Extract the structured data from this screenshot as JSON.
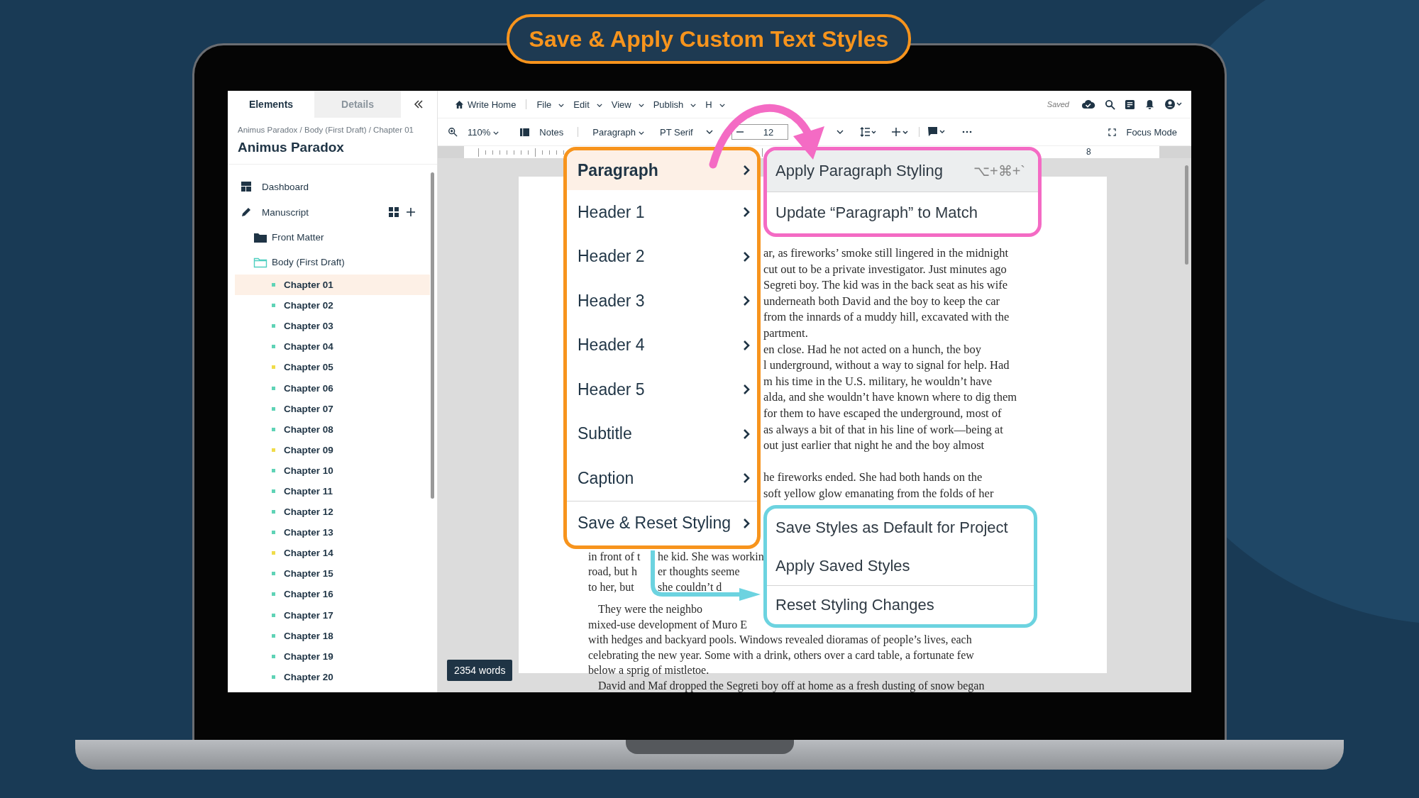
{
  "banner": {
    "title": "Save & Apply Custom Text Styles"
  },
  "sidebar": {
    "tabs": [
      {
        "label": "Elements",
        "selected": true
      },
      {
        "label": "Details",
        "selected": false
      }
    ],
    "breadcrumb": "Animus Paradox / Body (First Draft) / Chapter 01",
    "project_title": "Animus Paradox",
    "nav": [
      {
        "label": "Dashboard",
        "kind": "dashboard"
      },
      {
        "label": "Manuscript",
        "kind": "manuscript"
      }
    ],
    "folders": [
      {
        "label": "Front Matter",
        "kind": "closed"
      },
      {
        "label": "Body (First Draft)",
        "kind": "open"
      }
    ],
    "chapters": [
      {
        "label": "Chapter 01",
        "color": "#5fd3b6",
        "selected": true
      },
      {
        "label": "Chapter 02",
        "color": "#5fd3b6",
        "selected": false
      },
      {
        "label": "Chapter 03",
        "color": "#5fd3b6",
        "selected": false
      },
      {
        "label": "Chapter 04",
        "color": "#5fd3b6",
        "selected": false
      },
      {
        "label": "Chapter 05",
        "color": "#f0dc4a",
        "selected": false
      },
      {
        "label": "Chapter 06",
        "color": "#5fd3b6",
        "selected": false
      },
      {
        "label": "Chapter 07",
        "color": "#5fd3b6",
        "selected": false
      },
      {
        "label": "Chapter 08",
        "color": "#5fd3b6",
        "selected": false
      },
      {
        "label": "Chapter 09",
        "color": "#f0dc4a",
        "selected": false
      },
      {
        "label": "Chapter 10",
        "color": "#5fd3b6",
        "selected": false
      },
      {
        "label": "Chapter 11",
        "color": "#5fd3b6",
        "selected": false
      },
      {
        "label": "Chapter 12",
        "color": "#5fd3b6",
        "selected": false
      },
      {
        "label": "Chapter 13",
        "color": "#5fd3b6",
        "selected": false
      },
      {
        "label": "Chapter 14",
        "color": "#f0dc4a",
        "selected": false
      },
      {
        "label": "Chapter 15",
        "color": "#5fd3b6",
        "selected": false
      },
      {
        "label": "Chapter 16",
        "color": "#5fd3b6",
        "selected": false
      },
      {
        "label": "Chapter 17",
        "color": "#5fd3b6",
        "selected": false
      },
      {
        "label": "Chapter 18",
        "color": "#5fd3b6",
        "selected": false
      },
      {
        "label": "Chapter 19",
        "color": "#5fd3b6",
        "selected": false
      },
      {
        "label": "Chapter 20",
        "color": "#5fd3b6",
        "selected": false
      }
    ]
  },
  "menubar": {
    "home": "Write Home",
    "menus": [
      "File",
      "Edit",
      "View",
      "Publish",
      "H"
    ],
    "status": "Saved"
  },
  "toolbar": {
    "zoom": "110%",
    "notes": "Notes",
    "style": "Paragraph",
    "font": "PT Serif",
    "font_size": "12",
    "focus": "Focus Mode"
  },
  "ruler": {
    "mark": "8"
  },
  "document": {
    "word_count": "2354 words",
    "top_lines": [
      "ar, as fireworks’ smoke still lingered in the midnight",
      "cut out to be a private investigator. Just minutes ago",
      "Segreti boy. The kid was in the back seat as his wife",
      "underneath both David and the boy to keep the car",
      "from the innards of a muddy hill, excavated with the",
      "partment.",
      "en close. Had he not acted on a hunch, the boy",
      "l underground, without a way to signal for help. Had",
      "m his time in the U.S. military, he wouldn’t have",
      "alda, and she wouldn’t have known where to dig them",
      "for them to have escaped the underground, most of",
      "as always a bit of that in his line of work—being at",
      "out just earlier that night he and the boy almost"
    ],
    "middle_lines": [
      "he fireworks ended. She had both hands on the",
      "soft yellow glow emanating from the folds of her"
    ],
    "bottom_lines": [
      {
        "parts": [
          "in front of t",
          "he kid. She was workin"
        ],
        "indent": false
      },
      {
        "parts": [
          "road, but h",
          "er thoughts seeme"
        ],
        "indent": false
      },
      {
        "parts": [
          "to her, but",
          "she couldn’t d"
        ],
        "indent": false
      },
      {
        "parts": [
          "They were the neighbo"
        ],
        "indent": true
      },
      {
        "parts": [
          "mixed-use development of Muro E"
        ],
        "indent": false
      },
      {
        "parts": [
          "with hedges and backyard pools. Windows revealed dioramas of people’s lives, each"
        ],
        "indent": false
      },
      {
        "parts": [
          "celebrating the new year. Some with a drink, others over a card table, a fortunate few"
        ],
        "indent": false
      },
      {
        "parts": [
          "below a sprig of mistletoe."
        ],
        "indent": false
      },
      {
        "parts": [
          "David and Maf dropped the Segreti boy off at home as a fresh dusting of snow began"
        ],
        "indent": true
      }
    ]
  },
  "style_menu": {
    "items": [
      {
        "label": "Paragraph",
        "selected": true,
        "separated": false
      },
      {
        "label": "Header 1",
        "selected": false,
        "separated": false
      },
      {
        "label": "Header 2",
        "selected": false,
        "separated": false
      },
      {
        "label": "Header 3",
        "selected": false,
        "separated": false
      },
      {
        "label": "Header 4",
        "selected": false,
        "separated": false
      },
      {
        "label": "Header 5",
        "selected": false,
        "separated": false
      },
      {
        "label": "Subtitle",
        "selected": false,
        "separated": false
      },
      {
        "label": "Caption",
        "selected": false,
        "separated": false
      },
      {
        "label": "Save & Reset Styling",
        "selected": false,
        "separated": true
      }
    ]
  },
  "paragraph_submenu": {
    "items": [
      {
        "label": "Apply Paragraph Styling",
        "shortcut": "⌥+⌘+`",
        "highlighted": true,
        "separated": false
      },
      {
        "label": "Update “Paragraph” to Match",
        "highlighted": false,
        "separated": true
      }
    ]
  },
  "save_submenu": {
    "items": [
      {
        "label": "Save Styles as Default for Project",
        "highlighted": false,
        "separated": false
      },
      {
        "label": "Apply Saved Styles",
        "highlighted": false,
        "separated": false
      },
      {
        "label": "Reset Styling Changes",
        "highlighted": false,
        "separated": true
      }
    ]
  }
}
